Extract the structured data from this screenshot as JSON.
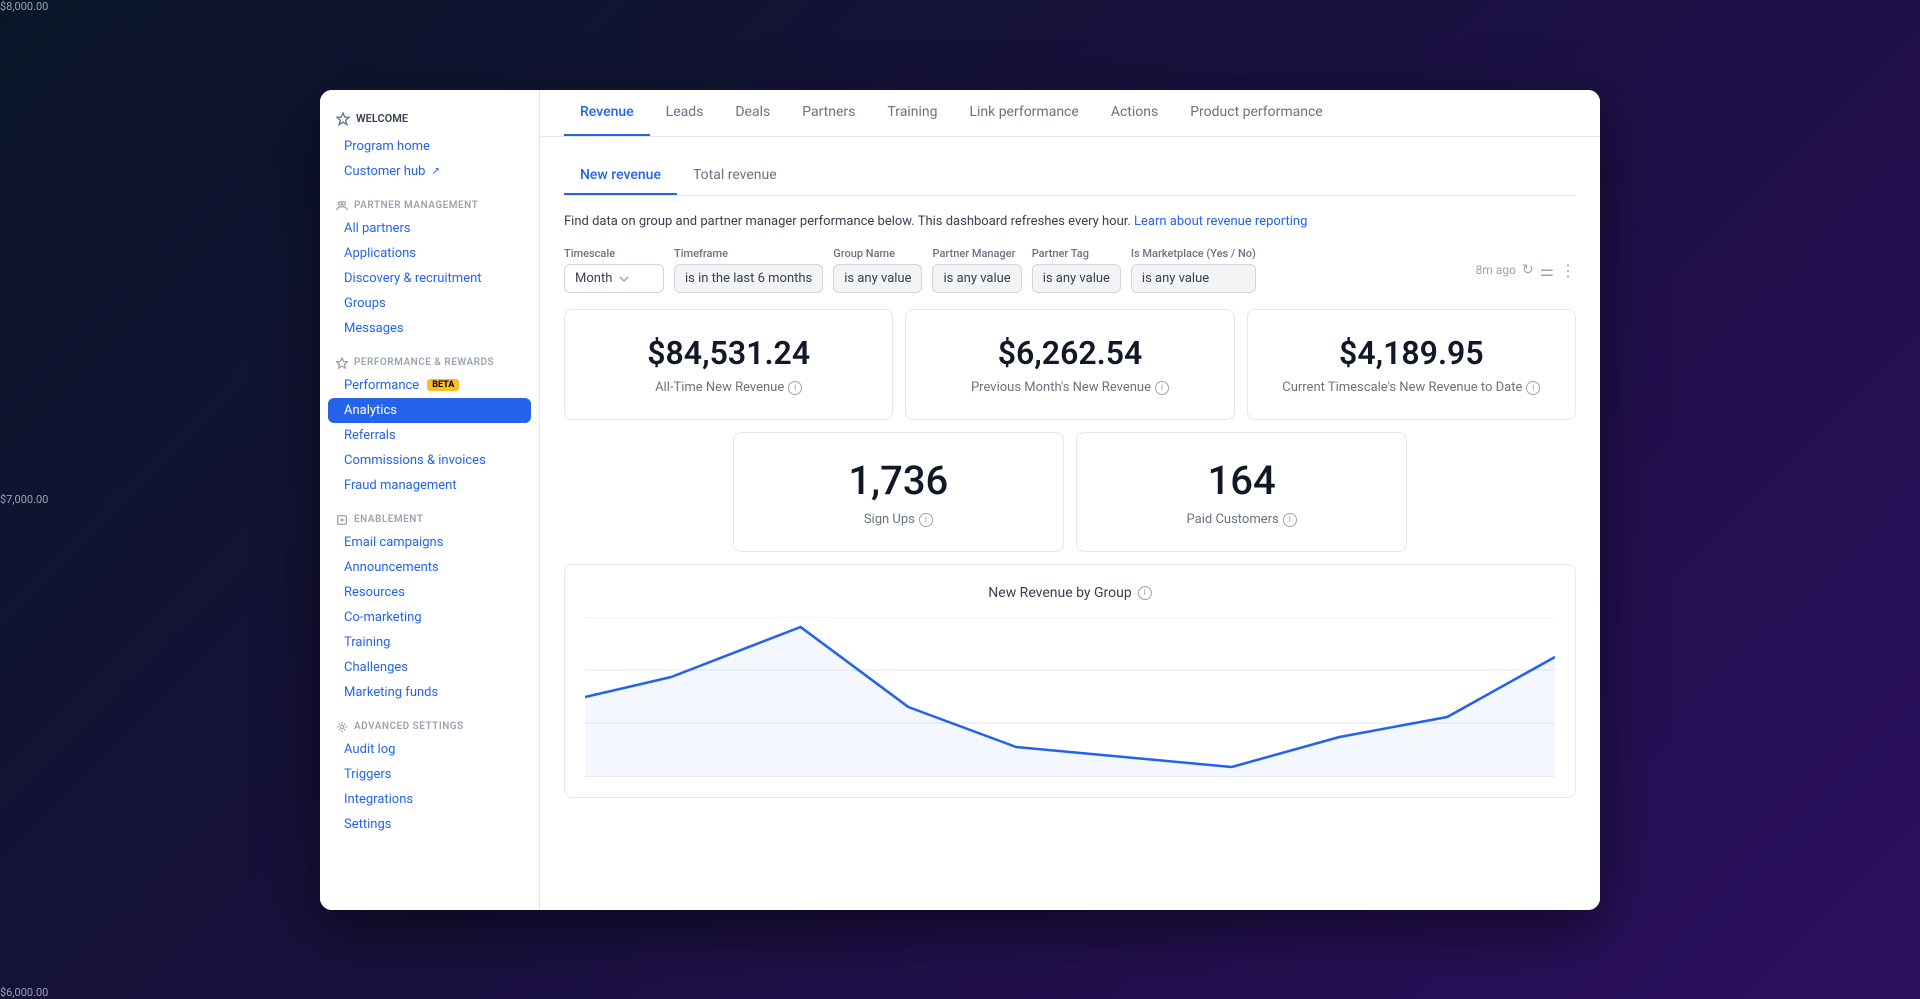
{
  "sidebar": {
    "welcome_header": "WELCOME",
    "program_home": "Program home",
    "customer_hub": "Customer hub",
    "partner_management_header": "PARTNER MANAGEMENT",
    "all_partners": "All partners",
    "applications": "Applications",
    "discovery_recruitment": "Discovery & recruitment",
    "groups": "Groups",
    "messages": "Messages",
    "performance_rewards_header": "PERFORMANCE & REWARDS",
    "performance": "Performance",
    "beta_label": "BETA",
    "analytics": "Analytics",
    "referrals": "Referrals",
    "commissions_invoices": "Commissions & invoices",
    "fraud_management": "Fraud management",
    "enablement_header": "ENABLEMENT",
    "email_campaigns": "Email campaigns",
    "announcements": "Announcements",
    "resources": "Resources",
    "co_marketing": "Co-marketing",
    "training": "Training",
    "challenges": "Challenges",
    "marketing_funds": "Marketing funds",
    "advanced_settings_header": "ADVANCED SETTINGS",
    "audit_log": "Audit log",
    "triggers": "Triggers",
    "integrations": "Integrations",
    "settings": "Settings"
  },
  "top_tabs": [
    {
      "label": "Revenue",
      "active": true
    },
    {
      "label": "Leads",
      "active": false
    },
    {
      "label": "Deals",
      "active": false
    },
    {
      "label": "Partners",
      "active": false
    },
    {
      "label": "Training",
      "active": false
    },
    {
      "label": "Link performance",
      "active": false
    },
    {
      "label": "Actions",
      "active": false
    },
    {
      "label": "Product performance",
      "active": false
    }
  ],
  "sub_tabs": [
    {
      "label": "New revenue",
      "active": true
    },
    {
      "label": "Total revenue",
      "active": false
    }
  ],
  "info_text": "Find data on group and partner manager performance below. This dashboard refreshes every hour.",
  "learn_link": "Learn about revenue reporting",
  "filters": {
    "timescale_label": "Timescale",
    "timescale_value": "Month",
    "timeframe_label": "Timeframe",
    "timeframe_value": "is in the last 6 months",
    "group_name_label": "Group Name",
    "group_name_value": "is any value",
    "partner_manager_label": "Partner Manager",
    "partner_manager_value": "is any value",
    "partner_tag_label": "Partner Tag",
    "partner_tag_value": "is any value",
    "is_marketplace_label": "Is Marketplace (Yes / No)",
    "is_marketplace_value": "is any value",
    "last_updated": "8m ago"
  },
  "stats": {
    "all_time_revenue": "$84,531.24",
    "all_time_revenue_label": "All-Time New Revenue",
    "prev_month_revenue": "$6,262.54",
    "prev_month_revenue_label": "Previous Month's New Revenue",
    "current_timescale_revenue": "$4,189.95",
    "current_timescale_revenue_label": "Current Timescale's New Revenue to Date",
    "sign_ups": "1,736",
    "sign_ups_label": "Sign Ups",
    "paid_customers": "164",
    "paid_customers_label": "Paid Customers"
  },
  "chart": {
    "title": "New Revenue by Group",
    "y_labels": [
      "$8,000.00",
      "$7,000.00",
      "$6,000.00"
    ],
    "line_color": "#2563eb"
  }
}
